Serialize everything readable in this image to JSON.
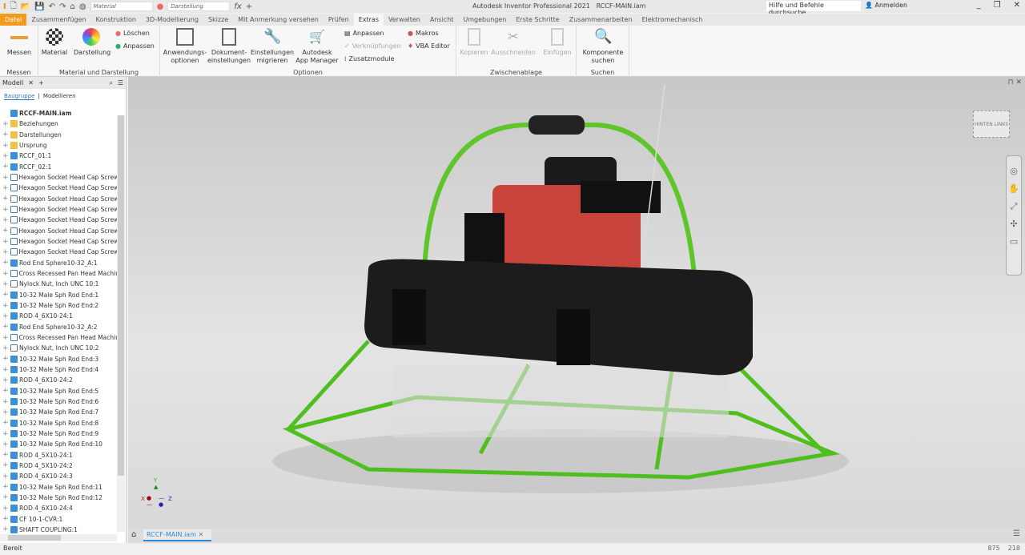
{
  "title": {
    "app": "Autodesk Inventor Professional 2021",
    "file": "RCCF-MAIN.iam",
    "material_combo": "Material",
    "appearance_combo": "Darstellung",
    "search_placeholder": "Hilfe und Befehle durchsuche",
    "signin": "Anmelden"
  },
  "tabs": [
    "Datei",
    "Zusammenfügen",
    "Konstruktion",
    "3D-Modellierung",
    "Skizze",
    "Mit Anmerkung versehen",
    "Prüfen",
    "Extras",
    "Verwalten",
    "Ansicht",
    "Umgebungen",
    "Erste Schritte",
    "Zusammenarbeiten",
    "Elektromechanisch"
  ],
  "active_tab": "Extras",
  "ribbon": {
    "messen": {
      "btn": "Messen",
      "label": "Messen"
    },
    "material": {
      "material": "Material",
      "darstellung": "Darstellung",
      "loeschen": "Löschen",
      "anpassen": "Anpassen",
      "label": "Material und Darstellung"
    },
    "optionen": {
      "anw": "Anwendungs-",
      "anw2": "optionen",
      "dok": "Dokument-",
      "dok2": "einstellungen",
      "ein": "Einstellungen",
      "ein2": "migrieren",
      "app": "Autodesk",
      "app2": "App Manager",
      "anpassen": "Anpassen",
      "verkn": "Verknüpfungen",
      "zusatz": "Zusatzmodule",
      "makros": "Makros",
      "vba": "VBA Editor",
      "label": "Optionen"
    },
    "zwischen": {
      "kopieren": "Kopieren",
      "ausschneiden": "Ausschneiden",
      "einfuegen": "Einfügen",
      "label": "Zwischenablage"
    },
    "suchen": {
      "k1": "Komponente",
      "k2": "suchen",
      "label": "Suchen"
    }
  },
  "browser": {
    "tab": "Modell",
    "sub_active": "Baugruppe",
    "sub_other": "Modellieren",
    "items": [
      "RCCF-MAIN.iam",
      "Beziehungen",
      "Darstellungen",
      "Ursprung",
      "RCCF_01:1",
      "RCCF_02:1",
      "Hexagon Socket Head Cap Screw - In",
      "Hexagon Socket Head Cap Screw - In",
      "Hexagon Socket Head Cap Screw - In",
      "Hexagon Socket Head Cap Screw - In",
      "Hexagon Socket Head Cap Screw - In",
      "Hexagon Socket Head Cap Screw - In",
      "Hexagon Socket Head Cap Screw - In",
      "Hexagon Socket Head Cap Screw - In",
      "Rod End Sphere10-32_A:1",
      "Cross Recessed Pan Head Machine Sc",
      "Nylock Nut, Inch UNC 10:1",
      "10-32 Male Sph Rod End:1",
      "10-32 Male Sph Rod End:2",
      "ROD 4_6X10-24:1",
      "Rod End Sphere10-32_A:2",
      "Cross Recessed Pan Head Machine Sc",
      "Nylock Nut, Inch UNC 10:2",
      "10-32 Male Sph Rod End:3",
      "10-32 Male Sph Rod End:4",
      "ROD 4_6X10-24:2",
      "10-32 Male Sph Rod End:5",
      "10-32 Male Sph Rod End:6",
      "10-32 Male Sph Rod End:7",
      "10-32 Male Sph Rod End:8",
      "10-32 Male Sph Rod End:9",
      "10-32 Male Sph Rod End:10",
      "ROD 4_5X10-24:1",
      "ROD 4_5X10-24:2",
      "ROD 4_6X10-24:3",
      "10-32 Male Sph Rod End:11",
      "10-32 Male Sph Rod End:12",
      "ROD 4_6X10-24:4",
      "CF 10-1-CVR:1",
      "SHAFT COUPLING:1"
    ]
  },
  "viewcube": {
    "left": "HINTEN",
    "right": "LINKS"
  },
  "axes": {
    "x": "X",
    "y": "Y",
    "z": "Z"
  },
  "doc_tab": "RCCF-MAIN.iam",
  "status": {
    "text": "Bereit",
    "n1": "875",
    "n2": "218"
  },
  "colors": {
    "file_tab": "#f39a1d",
    "frame_green": "#5ec52a",
    "engine_red": "#c9433d",
    "accent": "#2a8ad6"
  }
}
